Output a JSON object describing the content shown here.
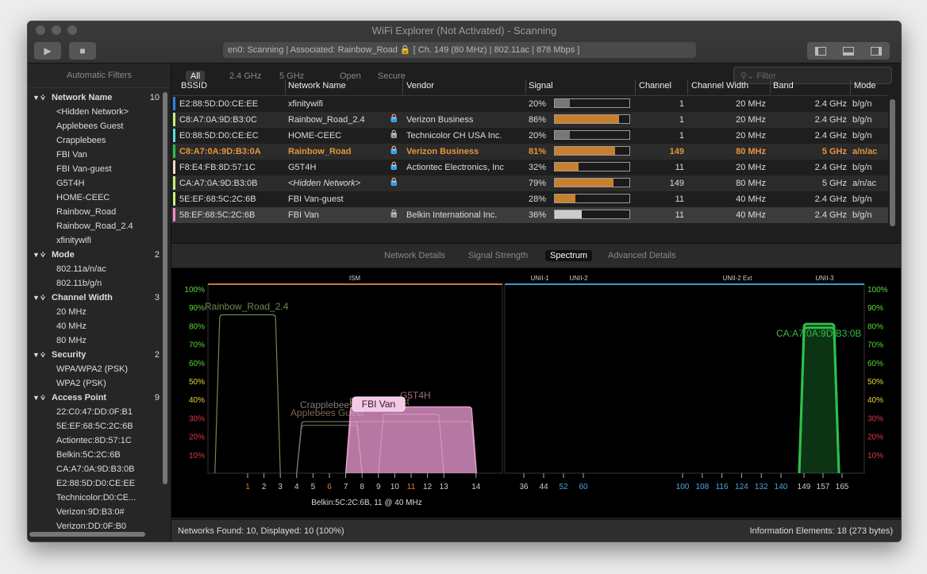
{
  "window": {
    "title": "WiFi Explorer (Not Activated) - Scanning",
    "status": "en0: Scanning  |  Associated: Rainbow_Road 🔒 [ Ch. 149 (80 MHz) | 802.11ac | 878 Mbps ]"
  },
  "sidebar": {
    "header": "Automatic Filters",
    "groups": [
      {
        "label": "Network Name",
        "count": "10",
        "items": [
          "<Hidden Network>",
          "Applebees Guest",
          "Crapplebees",
          "FBI Van",
          "FBI Van-guest",
          "G5T4H",
          "HOME-CEEC",
          "Rainbow_Road",
          "Rainbow_Road_2.4",
          "xfinitywifi"
        ]
      },
      {
        "label": "Mode",
        "count": "2",
        "items": [
          "802.11a/n/ac",
          "802.11b/g/n"
        ]
      },
      {
        "label": "Channel Width",
        "count": "3",
        "items": [
          "20 MHz",
          "40 MHz",
          "80 MHz"
        ]
      },
      {
        "label": "Security",
        "count": "2",
        "items": [
          "WPA/WPA2 (PSK)",
          "WPA2 (PSK)"
        ]
      },
      {
        "label": "Access Point",
        "count": "9",
        "items": [
          "22:C0:47:DD:0F:B1",
          "5E:EF:68:5C:2C:6B",
          "Actiontec:8D:57:1C",
          "Belkin:5C:2C:6B",
          "CA:A7:0A:9D:B3:0B",
          "E2:88:5D:D0:CE:EE",
          "Technicolor:D0:CE...",
          "Verizon:9D:B3:0#",
          "Verizon:DD:0F:B0"
        ]
      }
    ]
  },
  "filters": {
    "tabs": [
      "All",
      "2.4 GHz",
      "5 GHz",
      "Open",
      "Secure"
    ],
    "search_placeholder": "Filter"
  },
  "table": {
    "columns": [
      "BSSID",
      "Network Name",
      "Vendor",
      "Signal",
      "Channel",
      "Channel Width",
      "Band",
      "Mode"
    ],
    "rows": [
      {
        "color": "#2f7fe0",
        "bssid": "E2:88:5D:D0:CE:EE",
        "name": "xfinitywifi",
        "lock": "",
        "vendor": "",
        "signal": "20%",
        "level": 0.2,
        "fill": "#777777",
        "channel": "1",
        "width": "20 MHz",
        "band": "2.4 GHz",
        "mode": "b/g/n"
      },
      {
        "color": "#c8f07a",
        "bssid": "C8:A7:0A:9D:B3:0C",
        "name": "Rainbow_Road_2.4",
        "lock": "blue",
        "vendor": "Verizon Business",
        "signal": "86%",
        "level": 0.86,
        "fill": "#c8802e",
        "channel": "1",
        "width": "20 MHz",
        "band": "2.4 GHz",
        "mode": "b/g/n"
      },
      {
        "color": "#5fd6e8",
        "bssid": "E0:88:5D:D0:CE:EC",
        "name": "HOME-CEEC",
        "lock": "gray",
        "vendor": "Technicolor CH USA Inc.",
        "signal": "20%",
        "level": 0.2,
        "fill": "#777777",
        "channel": "1",
        "width": "20 MHz",
        "band": "2.4 GHz",
        "mode": "b/g/n"
      },
      {
        "color": "#2fbf4a",
        "bssid": "C8:A7:0A:9D:B3:0A",
        "name": "Rainbow_Road",
        "lock": "blue",
        "vendor": "Verizon Business",
        "signal": "81%",
        "level": 0.81,
        "fill": "#c8802e",
        "channel": "149",
        "width": "80 MHz",
        "band": "5 GHz",
        "mode": "a/n/ac",
        "bold": true
      },
      {
        "color": "#f5dcc0",
        "bssid": "F8:E4:FB:8D:57:1C",
        "name": "G5T4H",
        "lock": "blue",
        "vendor": "Actiontec Electronics, Inc",
        "signal": "32%",
        "level": 0.32,
        "fill": "#c8802e",
        "channel": "11",
        "width": "20 MHz",
        "band": "2.4 GHz",
        "mode": "b/g/n"
      },
      {
        "color": "#c8f07a",
        "bssid": "CA:A7:0A:9D:B3:0B",
        "name": "<Hidden Network>",
        "lock": "blue",
        "vendor": "",
        "signal": "79%",
        "level": 0.79,
        "fill": "#c8802e",
        "channel": "149",
        "width": "80 MHz",
        "band": "5 GHz",
        "mode": "a/n/ac",
        "italic": true
      },
      {
        "color": "#c8f07a",
        "bssid": "5E:EF:68:5C:2C:6B",
        "name": "FBI Van-guest",
        "lock": "",
        "vendor": "",
        "signal": "28%",
        "level": 0.28,
        "fill": "#c8802e",
        "channel": "11",
        "width": "40 MHz",
        "band": "2.4 GHz",
        "mode": "b/g/n"
      },
      {
        "color": "#f08ad0",
        "bssid": "58:EF:68:5C:2C:6B",
        "name": "FBI Van",
        "lock": "gray",
        "vendor": "Belkin International Inc.",
        "signal": "36%",
        "level": 0.36,
        "fill": "#cccccc",
        "channel": "11",
        "width": "40 MHz",
        "band": "2.4 GHz",
        "mode": "b/g/n",
        "selected": true
      }
    ]
  },
  "detail_tabs": [
    "Network Details",
    "Signal Strength",
    "Spectrum",
    "Advanced Details"
  ],
  "detail_active": "Spectrum",
  "chart_data": {
    "type": "area",
    "bands": [
      "ISM",
      "UNII-1",
      "UNII-2",
      "UNII-2 Ext",
      "UNII-3"
    ],
    "y_ticks": [
      "100%",
      "90%",
      "80%",
      "70%",
      "60%",
      "50%",
      "40%",
      "30%",
      "20%",
      "10%"
    ],
    "x_ticks_24": [
      {
        "label": "1",
        "color": "#e07a2a"
      },
      {
        "label": "2",
        "color": "#cccccc"
      },
      {
        "label": "3",
        "color": "#cccccc"
      },
      {
        "label": "4",
        "color": "#cccccc"
      },
      {
        "label": "5",
        "color": "#cccccc"
      },
      {
        "label": "6",
        "color": "#e07a2a"
      },
      {
        "label": "7",
        "color": "#cccccc"
      },
      {
        "label": "8",
        "color": "#cccccc"
      },
      {
        "label": "9",
        "color": "#cccccc"
      },
      {
        "label": "10",
        "color": "#cccccc"
      },
      {
        "label": "11",
        "color": "#e07a2a"
      },
      {
        "label": "12",
        "color": "#cccccc"
      },
      {
        "label": "13",
        "color": "#cccccc"
      },
      {
        "label": "14",
        "color": "#cccccc"
      }
    ],
    "x_ticks_5": [
      {
        "label": "36",
        "color": "#cccccc"
      },
      {
        "label": "44",
        "color": "#cccccc"
      },
      {
        "label": "52",
        "color": "#4aa8e0"
      },
      {
        "label": "60",
        "color": "#4aa8e0"
      },
      {
        "label": "100",
        "color": "#4aa8e0"
      },
      {
        "label": "108",
        "color": "#4aa8e0"
      },
      {
        "label": "116",
        "color": "#4aa8e0"
      },
      {
        "label": "124",
        "color": "#4aa8e0"
      },
      {
        "label": "132",
        "color": "#4aa8e0"
      },
      {
        "label": "140",
        "color": "#4aa8e0"
      },
      {
        "label": "149",
        "color": "#cccccc"
      },
      {
        "label": "157",
        "color": "#cccccc"
      },
      {
        "label": "165",
        "color": "#cccccc"
      }
    ],
    "series": [
      {
        "name": "Rainbow_Road_2.4",
        "center": 1,
        "width_mhz": 20,
        "signal": 86,
        "color": "#6e8a4e"
      },
      {
        "name": "Applebees Guest",
        "center": 6,
        "width_mhz": 20,
        "signal": 26,
        "color": "#7a6a4a"
      },
      {
        "name": "Crapplebees",
        "center": 6,
        "width_mhz": 20,
        "signal": 28,
        "color": "#7a7a7a"
      },
      {
        "name": "FBI Van-guest",
        "center": 11,
        "width_mhz": 40,
        "signal": 28,
        "color": "#8a7a4a"
      },
      {
        "name": "G5T4H",
        "center": 11,
        "width_mhz": 20,
        "signal": 32,
        "color": "#a06a8a"
      },
      {
        "name": "FBI Van",
        "center": 11,
        "width_mhz": 40,
        "signal": 36,
        "color": "#f0a0d8"
      },
      {
        "name": "Rainbow_Road",
        "center": 149,
        "width_mhz": 80,
        "signal": 81,
        "color": "#2fbf4a"
      },
      {
        "name": "CA:A7:0A:9D:B3:0B",
        "center": 149,
        "width_mhz": 80,
        "signal": 79,
        "color": "#2fbf4a"
      }
    ],
    "selected_label": "FBI Van",
    "footnote": "Belkin:5C:2C:6B, 11 @ 40 MHz"
  },
  "statusbar": {
    "left": "Networks Found: 10, Displayed: 10 (100%)",
    "right": "Information Elements: 18 (273 bytes)"
  }
}
